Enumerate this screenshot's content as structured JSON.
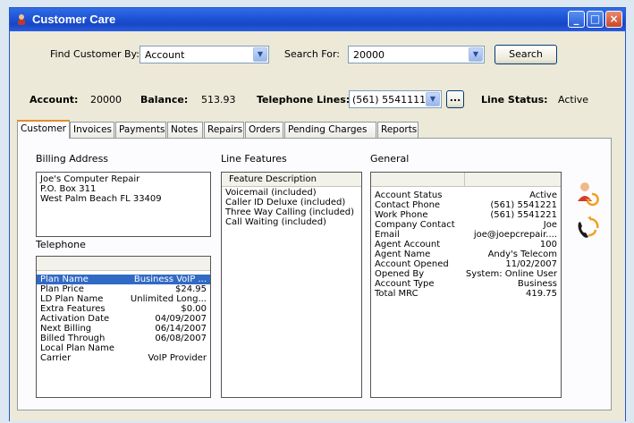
{
  "window": {
    "title": "Customer Care"
  },
  "search": {
    "find_label": "Find Customer By:",
    "find_value": "Account",
    "search_for_label": "Search For:",
    "search_for_value": "20000",
    "search_button": "Search"
  },
  "summary": {
    "account_label": "Account:",
    "account_value": "20000",
    "balance_label": "Balance:",
    "balance_value": "513.93",
    "lines_label": "Telephone Lines:",
    "lines_value": "(561) 5541111",
    "more_button": "...",
    "status_label": "Line Status:",
    "status_value": "Active"
  },
  "tabs": [
    "Customer",
    "Invoices",
    "Payments",
    "Notes",
    "Repairs",
    "Orders",
    "Pending Charges",
    "Reports"
  ],
  "billing": {
    "heading": "Billing Address",
    "lines": [
      "Joe's Computer Repair",
      "P.O. Box 311",
      "West Palm Beach FL 33409"
    ]
  },
  "telephone": {
    "heading": "Telephone",
    "rows": [
      {
        "k": "Plan Name",
        "v": "Business VoIP ..."
      },
      {
        "k": "Plan Price",
        "v": "$24.95"
      },
      {
        "k": "LD Plan Name",
        "v": "Unlimited Long..."
      },
      {
        "k": "Extra Features",
        "v": "$0.00"
      },
      {
        "k": "Activation Date",
        "v": "04/09/2007"
      },
      {
        "k": "Next Billing",
        "v": "06/14/2007"
      },
      {
        "k": "Billed Through",
        "v": "06/08/2007"
      },
      {
        "k": "Local Plan Name",
        "v": ""
      },
      {
        "k": "Carrier",
        "v": "VoIP Provider"
      }
    ]
  },
  "line_features": {
    "heading": "Line Features",
    "column": "Feature Description",
    "items": [
      "Voicemail (included)",
      "Caller ID Deluxe (included)",
      "Three Way Calling (included)",
      "Call Waiting (included)"
    ]
  },
  "general": {
    "heading": "General",
    "rows": [
      {
        "k": "Account Status",
        "v": "Active"
      },
      {
        "k": "Contact Phone",
        "v": "(561) 5541221"
      },
      {
        "k": "Work Phone",
        "v": "(561) 5541221"
      },
      {
        "k": "Company Contact",
        "v": "Joe"
      },
      {
        "k": "Email",
        "v": "joe@joepcrepair...."
      },
      {
        "k": "Agent Account",
        "v": "100"
      },
      {
        "k": "Agent Name",
        "v": "Andy's Telecom"
      },
      {
        "k": "Account Opened",
        "v": "11/02/2007"
      },
      {
        "k": "Opened By",
        "v": "System: Online User"
      },
      {
        "k": "Account Type",
        "v": "Business"
      },
      {
        "k": "Total MRC",
        "v": "419.75"
      }
    ]
  },
  "icons": {
    "refresh_user": "user-refresh-icon",
    "refresh_phone": "phone-refresh-icon"
  }
}
